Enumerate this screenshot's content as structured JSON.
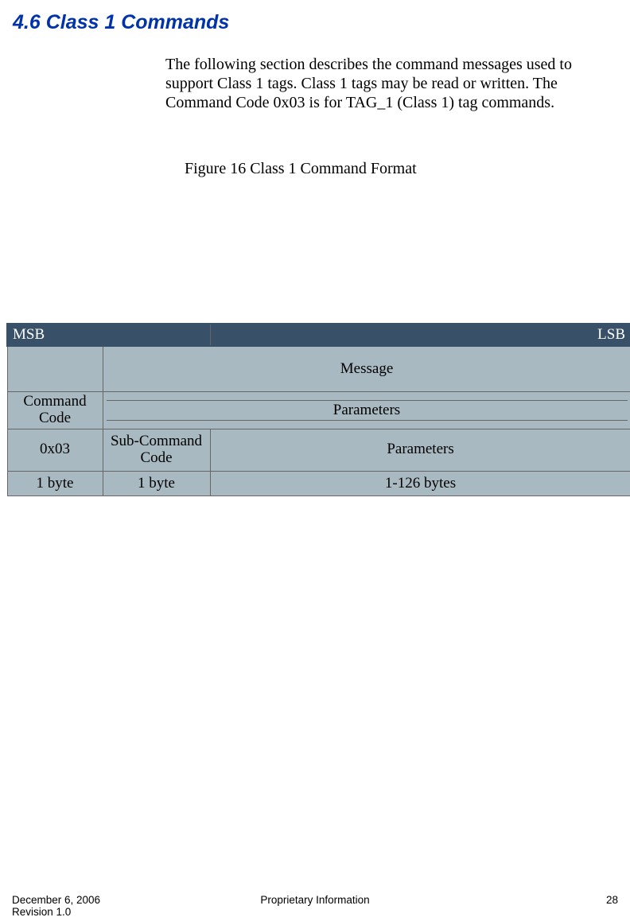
{
  "heading": "4.6  Class 1 Commands",
  "intro": "The following section describes the command messages used to support Class 1 tags.  Class 1 tags may be read or written.  The Command Code 0x03 is for TAG_1 (Class 1) tag commands.",
  "figure_caption": "Figure 16 Class 1 Command Format",
  "table": {
    "headerbar": {
      "left": "MSB",
      "right": "LSB"
    },
    "row1": {
      "blank": "",
      "message": "Message"
    },
    "row2": {
      "cmd": "Command Code",
      "param": "Parameters"
    },
    "row3": {
      "c1": "0x03",
      "c2": "Sub-Command Code",
      "c3": "Parameters"
    },
    "row4": {
      "c1": "1 byte",
      "c2": "1 byte",
      "c3": "1-126 bytes"
    }
  },
  "footer": {
    "date": "December 6, 2006",
    "rev": "Revision 1.0",
    "center": "Proprietary Information",
    "page": "28"
  }
}
